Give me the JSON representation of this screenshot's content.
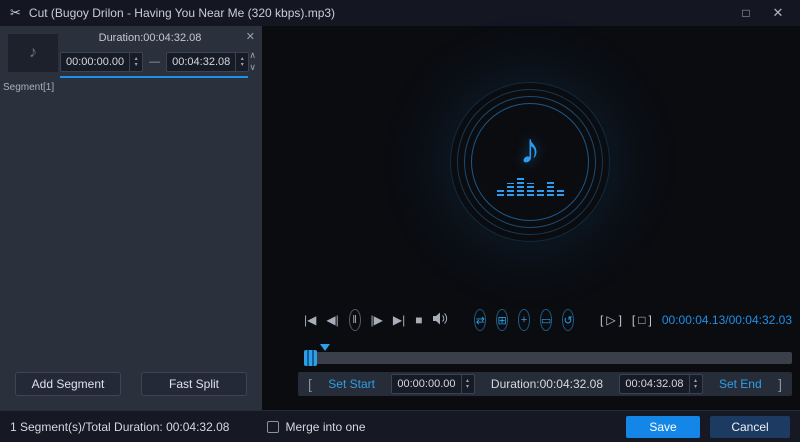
{
  "colors": {
    "accent": "#1f8fe8",
    "save_button": "#1486e8",
    "panel_bg": "#2b303d",
    "preview_bg": "#0b0c10"
  },
  "titlebar": {
    "scissors_icon": "✂",
    "title": "Cut (Bugoy Drilon - Having You Near Me (320 kbps).mp3)",
    "maximize_icon": "□",
    "close_icon": "✕"
  },
  "segment_panel": {
    "duration_header": "Duration:00:04:32.08",
    "remove_icon": "✕",
    "move_up_icon": "∧",
    "move_down_icon": "∨",
    "thumb_icon": "♪",
    "start_time": "00:00:00.00",
    "separator": "—",
    "end_time": "00:04:32.08",
    "segment_label": "Segment[1]",
    "add_segment_button": "Add Segment",
    "fast_split_button": "Fast Split"
  },
  "ui": {
    "spin_up": "▴",
    "spin_down": "▾"
  },
  "preview": {
    "note_icon": "♪"
  },
  "transport": {
    "skip_start_icon": "|◀",
    "step_back_icon": "◀|",
    "pause_icon": "‖",
    "step_forward_icon": "|▶",
    "skip_end_icon": "▶|",
    "stop_icon": "■",
    "split_icon": "⇄",
    "snapshot_icon": "⊞",
    "add_icon": "+",
    "crop_icon": "▭",
    "reset_icon": "↺",
    "bracket_left": "[",
    "bracket_right": "]",
    "play_segment_icon": "▷",
    "stop_segment_icon": "□",
    "time_display": "00:00:04.13/00:04:32.03"
  },
  "trim_bar": {
    "bracket_left": "[",
    "set_start_label": "Set Start",
    "start_value": "00:00:00.00",
    "duration_label": "Duration:00:04:32.08",
    "end_value": "00:04:32.08",
    "set_end_label": "Set End",
    "bracket_right": "]"
  },
  "footer": {
    "summary": "1 Segment(s)/Total Duration: 00:04:32.08",
    "merge_label": "Merge into one",
    "save_button": "Save",
    "cancel_button": "Cancel"
  }
}
